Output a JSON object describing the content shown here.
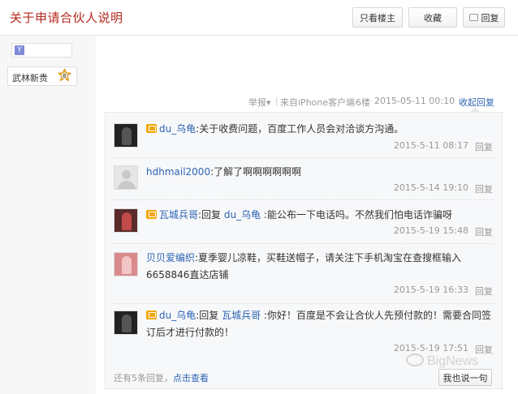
{
  "header": {
    "title": "关于申请合伙人说明",
    "only_op_label": "只看楼主",
    "favorite_label": "收藏",
    "reply_label": "回复"
  },
  "user": {
    "badge_icon": "Y",
    "rank_label": "武林新贵",
    "level": "8"
  },
  "post_meta": {
    "report": "举报▾",
    "separator": "|",
    "source": "来自iPhone客户端",
    "floor": "6楼",
    "time": "2015-05-11 00:10",
    "collapse": "收起回复"
  },
  "replies": [
    {
      "user": "du_乌龟",
      "member": true,
      "prefix": "",
      "target": "",
      "content": ":关于收费问题，百度工作人员会对洽谈方沟通。",
      "time": "2015-5-11 08:17",
      "reply": "回复"
    },
    {
      "user": "hdhmail2000",
      "member": false,
      "prefix": "",
      "target": "",
      "content": ":了解了啊啊啊啊啊啊",
      "time": "2015-5-14 19:10",
      "reply": "回复"
    },
    {
      "user": "瓦城兵哥",
      "member": true,
      "prefix": ":回复 ",
      "target": "du_乌龟",
      "content": " :能公布一下电话吗。不然我们怕电话诈骗呀",
      "time": "2015-5-19 15:48",
      "reply": "回复"
    },
    {
      "user": "贝贝爱编织",
      "member": false,
      "prefix": "",
      "target": "",
      "content": ":夏季婴儿凉鞋，买鞋送帽子，请关注下手机淘宝在查搜框输入6658846直达店铺",
      "time": "2015-5-19 16:33",
      "reply": "回复"
    },
    {
      "user": "du_乌龟",
      "member": true,
      "prefix": ":回复 ",
      "target": "瓦城兵哥",
      "content": " :你好！百度是不会让合伙人先预付款的！需要合同签订后才进行付款的！",
      "time": "2015-5-19 17:51",
      "reply": "回复"
    }
  ],
  "footer": {
    "more_prefix": "还有5条回复，",
    "more_link": "点击查看",
    "say_label": "我也说一句",
    "watermark": "BigNews"
  },
  "colors": {
    "title": "#b4281e",
    "link": "#2d64b3",
    "meta": "#999999"
  }
}
